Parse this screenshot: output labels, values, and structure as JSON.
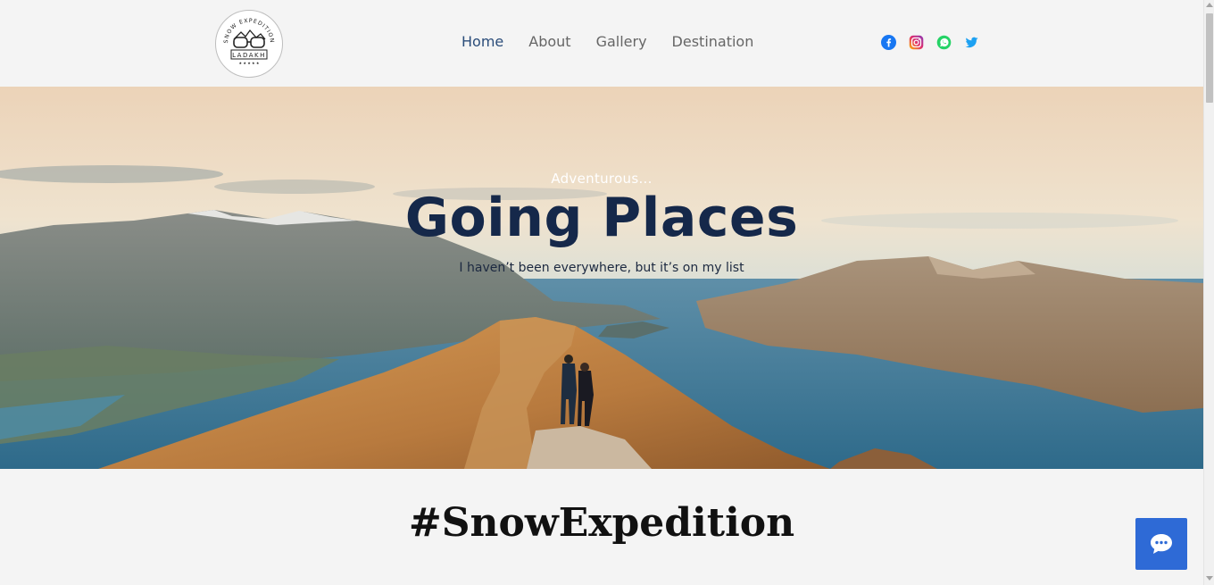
{
  "header": {
    "logo": {
      "top_text": "SNOW EXPEDITION",
      "bottom_text": "LADAKH"
    },
    "nav": [
      {
        "label": "Home",
        "active": true
      },
      {
        "label": "About",
        "active": false
      },
      {
        "label": "Gallery",
        "active": false
      },
      {
        "label": "Destination",
        "active": false
      }
    ],
    "social_icons": [
      "facebook-icon",
      "instagram-icon",
      "whatsapp-icon",
      "twitter-icon"
    ]
  },
  "hero": {
    "eyebrow": "Adventurous...",
    "title": "Going Places",
    "subtitle": "I haven’t been everywhere, but it’s on my list"
  },
  "section": {
    "title": "#SnowExpedition"
  },
  "chat": {
    "icon": "chat-bubble-icon"
  },
  "colors": {
    "nav_active": "#2b4d7a",
    "nav_default": "#666666",
    "hero_title": "#15284a",
    "chat_button": "#2e6ad6",
    "page_bg": "#f4f4f4"
  }
}
